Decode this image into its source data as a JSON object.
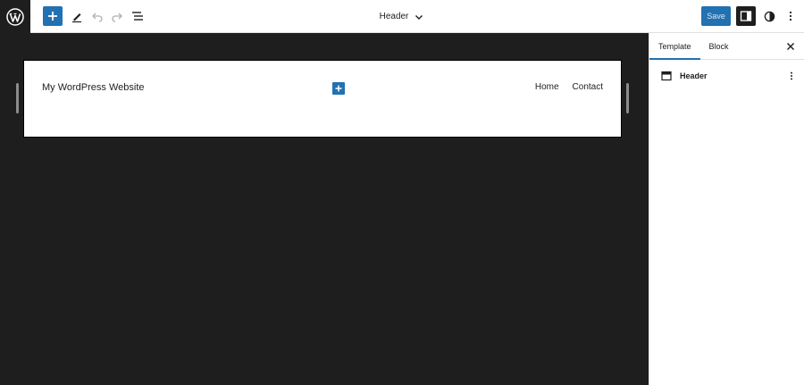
{
  "toolbar": {
    "document_title": "Header",
    "save_label": "Save"
  },
  "icons": {
    "logo": "wordpress-logo-icon",
    "add": "plus-icon",
    "tools": "pencil-icon",
    "undo": "undo-icon",
    "redo": "redo-icon",
    "list_view": "list-view-icon",
    "dropdown": "chevron-down-icon",
    "settings": "sidebar-toggle-icon",
    "styles": "half-circle-icon",
    "more": "vertical-ellipsis-icon",
    "close": "close-icon",
    "template_part": "layout-header-icon"
  },
  "canvas": {
    "site_title": "My WordPress Website",
    "nav_items": [
      "Home",
      "Contact"
    ]
  },
  "sidebar": {
    "tabs": [
      {
        "label": "Template",
        "active": true
      },
      {
        "label": "Block",
        "active": false
      }
    ],
    "template_part_label": "Header"
  },
  "colors": {
    "accent": "#2271b1",
    "canvas_bg": "#1e1e1e",
    "surface": "#ffffff"
  }
}
